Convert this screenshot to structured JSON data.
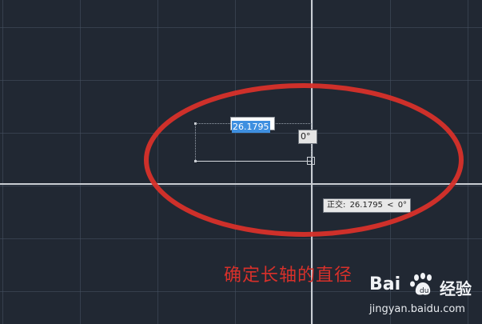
{
  "drawing": {
    "input_value": "26.1795",
    "angle_value": "0°",
    "tooltip": {
      "label": "正交:",
      "length": "26.1795",
      "separator": "<",
      "angle": "0°"
    }
  },
  "annotation": {
    "caption": "确定长轴的直径",
    "highlight_color": "#d8302a"
  },
  "watermark": {
    "brand_left": "Bai",
    "brand_right": "经验",
    "url": "jingyan.baidu.com",
    "paw_icon": "baidu-paw-icon"
  },
  "colors": {
    "background": "#212833",
    "crosshair": "#c9cdd3",
    "selection": "#3e8fe0"
  }
}
